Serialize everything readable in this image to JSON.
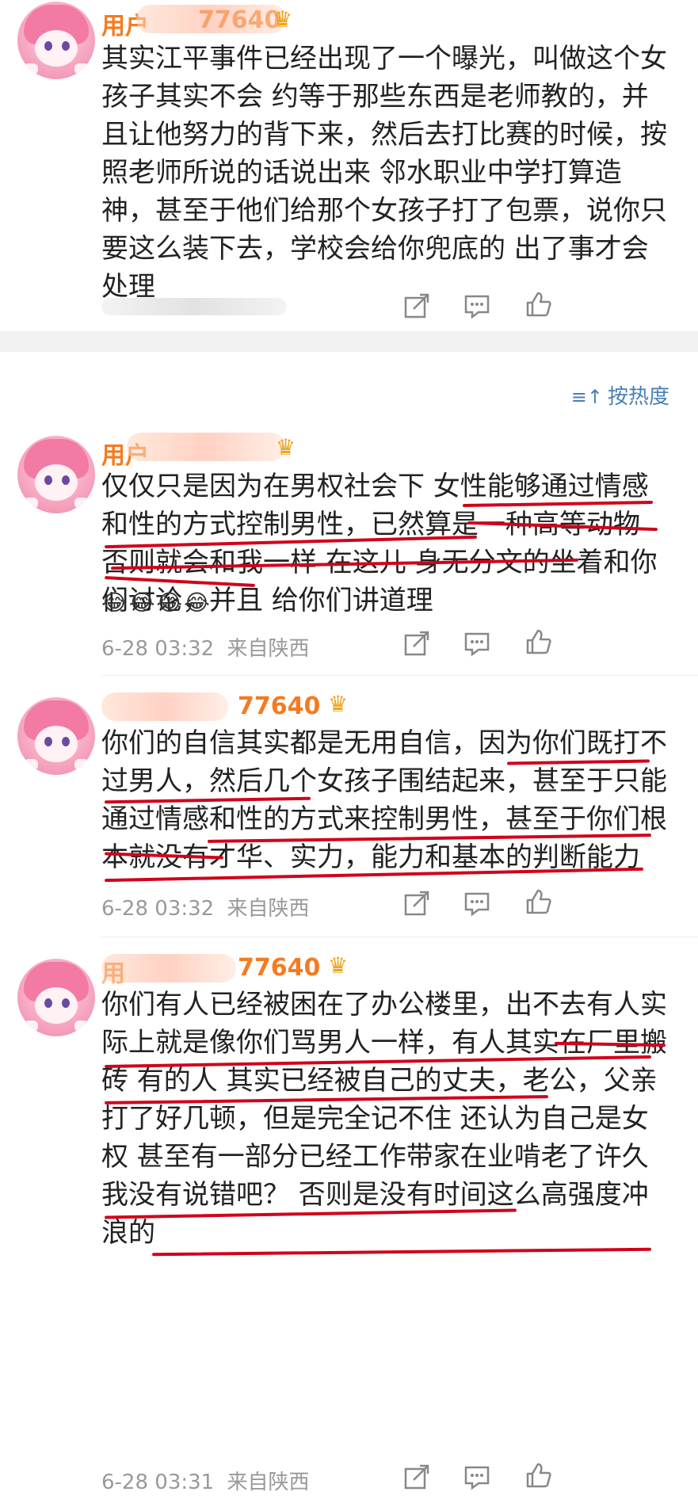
{
  "top_comment": {
    "username": "用户",
    "username_tail": "77640",
    "content": "其实江平事件已经出现了一个曝光，叫做这个女孩子其实不会 约等于那些东西是老师教的，并且让他努力的背下来，然后去打比赛的时候，按照老师所说的话说出来 邻水职业中学打算造神，甚至于他们给那个女孩子打了包票，说你只要这么装下去，学校会给你兜底的 出了事才会处理"
  },
  "sort": {
    "icon": "≡↑",
    "label": "按热度"
  },
  "comments": [
    {
      "username": "用户",
      "username_tail": "",
      "content": "仅仅只是因为在男权社会下 女性能够通过情感和性的方式控制男性，已然算是一种高等动物 否则就会和我一样 在这儿 身无分文的坐着和你们讨论，并且 给你们讲道理",
      "emojis": "😂😂😂😂",
      "time": "6-28 03:32",
      "location": "来自陕西"
    },
    {
      "username": "",
      "username_tail": "77640",
      "content": "你们的自信其实都是无用自信，因为你们既打不过男人，然后几个女孩子围结起来，甚至于只能通过情感和性的方式来控制男性，甚至于你们根本就没有才华、实力，能力和基本的判断能力",
      "time": "6-28 03:32",
      "location": "来自陕西"
    },
    {
      "username": "用",
      "username_tail": "77640",
      "content": "你们有人已经被困在了办公楼里，出不去有人实际上就是像你们骂男人一样，有人其实在厂里搬砖 有的人 其实已经被自己的丈夫，老公，父亲打了好几顿，但是完全记不住 还认为自己是女权 甚至有一部分已经工作带家在业啃老了许久 我没有说错吧？ 否则是没有时间这么高强度冲浪的",
      "time": "6-28 03:31",
      "location": "来自陕西"
    }
  ],
  "colors": {
    "username": "#f47b20",
    "underline": "#d0021b",
    "sort": "#4a7fb5",
    "meta": "#999999"
  }
}
